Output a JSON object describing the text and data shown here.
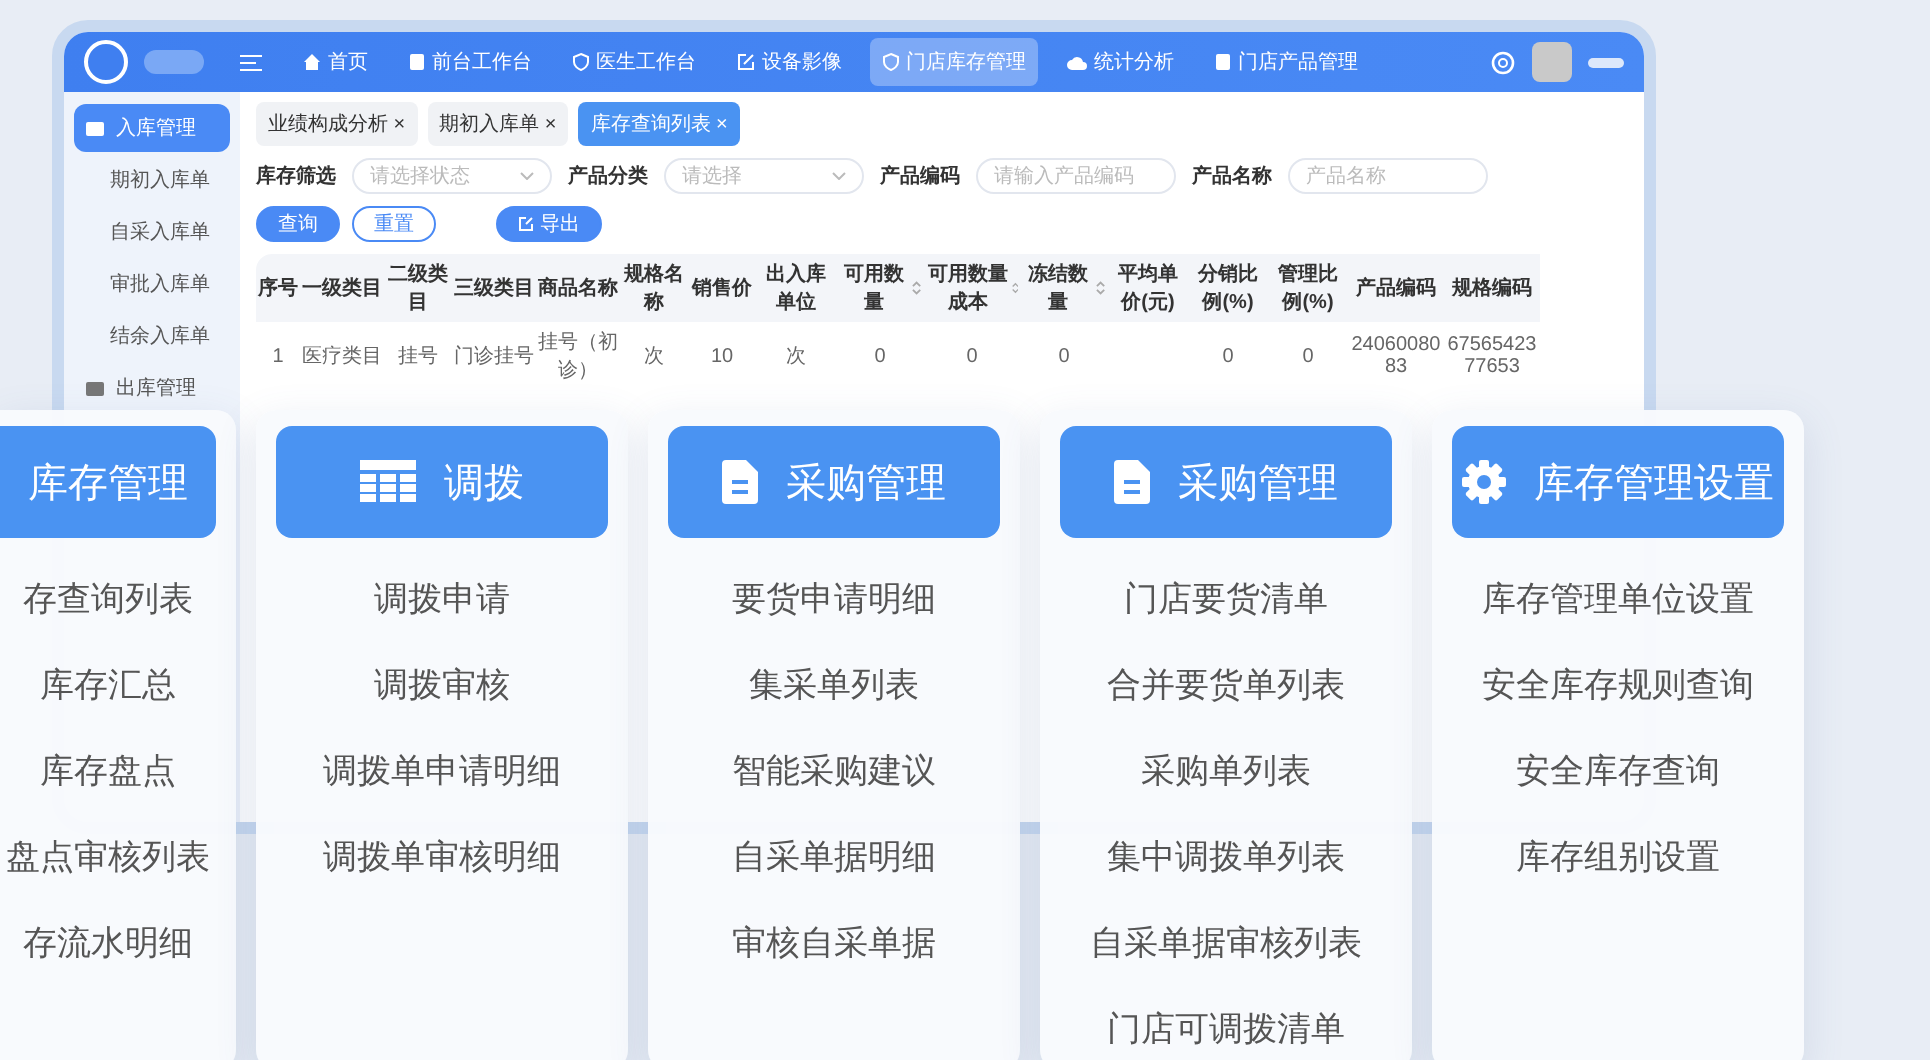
{
  "app": {
    "nav": [
      {
        "label": "首页",
        "selected": false
      },
      {
        "label": "前台工作台",
        "selected": false
      },
      {
        "label": "医生工作台",
        "selected": false
      },
      {
        "label": "设备影像",
        "selected": false
      },
      {
        "label": "门店库存管理",
        "selected": true
      },
      {
        "label": "统计分析",
        "selected": false
      },
      {
        "label": "门店产品管理",
        "selected": false
      }
    ],
    "sidebar": [
      {
        "label": "入库管理",
        "kind": "group",
        "selected": true
      },
      {
        "label": "期初入库单",
        "kind": "item",
        "selected": false
      },
      {
        "label": "自采入库单",
        "kind": "item",
        "selected": false
      },
      {
        "label": "审批入库单",
        "kind": "item",
        "selected": false
      },
      {
        "label": "结余入库单",
        "kind": "item",
        "selected": false
      },
      {
        "label": "出库管理",
        "kind": "group",
        "selected": false
      }
    ],
    "tabs": [
      {
        "label": "业绩构成分析",
        "close": "×",
        "selected": false
      },
      {
        "label": "期初入库单",
        "close": "×",
        "selected": false
      },
      {
        "label": "库存查询列表",
        "close": "×",
        "selected": true
      }
    ],
    "filters": [
      {
        "label": "库存筛选",
        "placeholder": "请选择状态",
        "kind": "select"
      },
      {
        "label": "产品分类",
        "placeholder": "请选择",
        "kind": "select"
      },
      {
        "label": "产品编码",
        "placeholder": "请输入产品编码",
        "kind": "input"
      },
      {
        "label": "产品名称",
        "placeholder": "产品名称",
        "kind": "input"
      }
    ],
    "buttons": [
      {
        "label": "查询",
        "kind": "primary"
      },
      {
        "label": "重置",
        "kind": "outline"
      },
      {
        "label": "导出",
        "kind": "export"
      }
    ],
    "table": {
      "columns": [
        {
          "label": "序号",
          "sortable": false
        },
        {
          "label": "一级类目",
          "sortable": false
        },
        {
          "label": "二级类目",
          "sortable": false
        },
        {
          "label": "三级类目",
          "sortable": false
        },
        {
          "label": "商品名称",
          "sortable": false
        },
        {
          "label": "规格名称",
          "sortable": false
        },
        {
          "label": "销售价",
          "sortable": false
        },
        {
          "label": "出入库单位",
          "sortable": false
        },
        {
          "label": "可用数量",
          "sortable": true
        },
        {
          "label": "可用数量成本",
          "sortable": true
        },
        {
          "label": "冻结数量",
          "sortable": true
        },
        {
          "label": "平均单价(元)",
          "sortable": false
        },
        {
          "label": "分销比例(%)",
          "sortable": false
        },
        {
          "label": "管理比例(%)",
          "sortable": false
        },
        {
          "label": "产品编码",
          "sortable": false
        },
        {
          "label": "规格编码",
          "sortable": false
        }
      ],
      "rows": [
        [
          "1",
          "医疗类目",
          "挂号",
          "门诊挂号",
          "挂号（初诊）",
          "次",
          "10",
          "次",
          "0",
          "0",
          "0",
          null,
          "0",
          "0",
          "2406008083",
          "6756542377653"
        ]
      ]
    }
  },
  "cards": [
    {
      "title": "库存管理",
      "items": [
        "存查询列表",
        "库存汇总",
        "库存盘点",
        "盘点审核列表",
        "存流水明细"
      ]
    },
    {
      "title": "调拨",
      "items": [
        "调拨申请",
        "调拨审核",
        "调拨单申请明细",
        "调拨单审核明细"
      ]
    },
    {
      "title": "采购管理",
      "items": [
        "要货申请明细",
        "集采单列表",
        "智能采购建议",
        "自采单据明细",
        "审核自采单据"
      ]
    },
    {
      "title": "采购管理",
      "items": [
        "门店要货清单",
        "合并要货单列表",
        "采购单列表",
        "集中调拨单列表",
        "自采单据审核列表",
        "门店可调拨清单"
      ]
    },
    {
      "title": "库存管理设置",
      "items": [
        "库存管理单位设置",
        "安全库存规则查询",
        "安全库存查询",
        "库存组别设置"
      ]
    }
  ]
}
